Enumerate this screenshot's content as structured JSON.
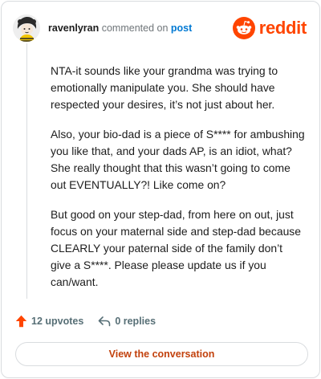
{
  "header": {
    "username": "ravenlyran",
    "action_text": "commented on",
    "post_link": "post",
    "brand": "reddit"
  },
  "comment": {
    "paragraphs": [
      "NTA-it sounds like your grandma was trying to emotionally manipulate you. She should have respected your desires, it’s not just about her.",
      "Also, your bio-dad is a piece of S**** for ambushing you like that, and your dads AP, is an idiot, what? She really thought that this wasn’t going to come out EVENTUALLY?! Like come on?",
      "But good on your step-dad, from here on out, just focus on your maternal side and step-dad because CLEARLY your paternal side of the family don’t give a S****. Please please update us if you can/want."
    ]
  },
  "footer": {
    "upvotes": "12 upvotes",
    "replies": "0 replies",
    "view_conversation": "View the conversation"
  },
  "colors": {
    "brand": "#ff4500",
    "upvote": "#ff4500",
    "link": "#0079d3",
    "button_text": "#c2410c"
  },
  "icons": {
    "avatar": "avatar-image",
    "brand": "reddit-alien-logo",
    "upvote": "upvote-arrow-icon",
    "reply": "reply-arrow-icon"
  }
}
